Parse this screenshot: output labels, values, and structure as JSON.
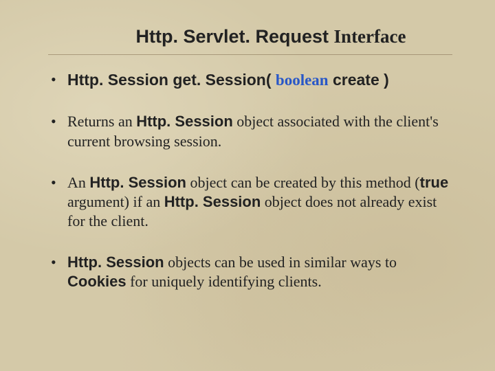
{
  "title": {
    "part1": "Http. Servlet. Request ",
    "part2": "Interface"
  },
  "bullets": {
    "b1": {
      "cls": "Http. Session",
      "method": " get. Session( ",
      "kw": "boolean",
      "tail": " create )"
    },
    "b2": {
      "pre": "Returns an ",
      "cls": "Http. Session",
      "post": " object associated with the client's current browsing session."
    },
    "b3": {
      "pre": "An ",
      "cls1": "Http. Session",
      "mid1": " object can be created by this method (",
      "true": "true",
      "mid2": " argument) if an ",
      "cls2": "Http. Session",
      "post": " object does not already exist for the client."
    },
    "b4": {
      "sp": " ",
      "cls": "Http. Session",
      "mid": " objects can be used in similar ways to ",
      "cookies": "Cookies",
      "post": " for uniquely identifying clients."
    }
  }
}
